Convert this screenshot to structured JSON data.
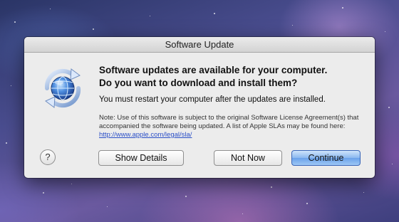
{
  "window": {
    "title": "Software Update"
  },
  "message": {
    "headline_line1": "Software updates are available for your computer.",
    "headline_line2": "Do you want to download and install them?",
    "restart_note": "You must restart your computer after the updates are installed.",
    "license_note_prefix": "Note: Use of this software is subject to the original Software License Agreement(s) that accompanied the software being updated. A list of Apple SLAs may be found here: ",
    "license_link": "http://www.apple.com/legal/sla/"
  },
  "buttons": {
    "help": "?",
    "show_details": "Show Details",
    "not_now": "Not Now",
    "continue": "Continue"
  },
  "icons": {
    "app": "software-update-globe-icon"
  },
  "colors": {
    "default_button": "#6aa2ea",
    "link": "#2a4fc7"
  }
}
